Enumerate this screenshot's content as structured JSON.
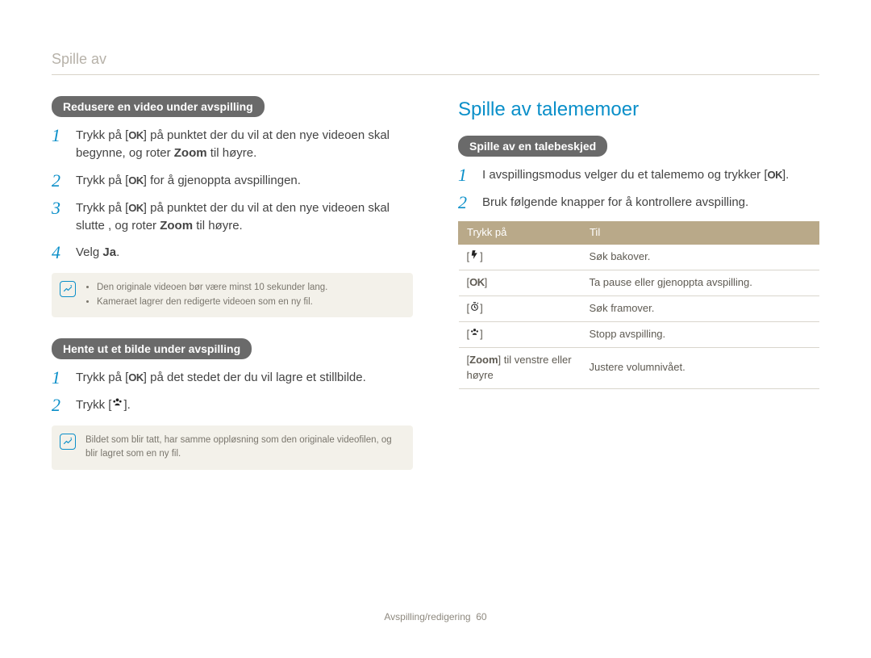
{
  "header": {
    "title": "Spille av"
  },
  "left": {
    "section_a": {
      "label": "Redusere en video under avspilling",
      "steps": [
        {
          "n": "1",
          "pre": "Trykk på [",
          "ok": "OK",
          "post": "] på punktet der du vil at den nye videoen skal begynne, og roter ",
          "zoom": "Zoom",
          "tail": " til høyre."
        },
        {
          "n": "2",
          "pre": "Trykk på [",
          "ok": "OK",
          "post": "] for å gjenoppta avspillingen."
        },
        {
          "n": "3",
          "pre": "Trykk på [",
          "ok": "OK",
          "post": "] på punktet der du vil at den nye videoen skal slutte , og roter ",
          "zoom": "Zoom",
          "tail": " til høyre."
        },
        {
          "n": "4",
          "text_pre": "Velg ",
          "ja": "Ja",
          "text_post": "."
        }
      ],
      "note": [
        "Den originale videoen bør være minst 10 sekunder lang.",
        "Kameraet lagrer den redigerte videoen som en ny fil."
      ]
    },
    "section_b": {
      "label": "Hente ut et bilde under avspilling",
      "steps": [
        {
          "n": "1",
          "pre": "Trykk på [",
          "ok": "OK",
          "post": "] på det stedet der du vil lagre et stillbilde."
        },
        {
          "n": "2",
          "text": "Trykk [",
          "icon": "macro",
          "tail": "]."
        }
      ],
      "note": "Bildet som blir tatt, har samme oppløsning som den originale videofilen, og blir lagret som en ny fil."
    }
  },
  "right": {
    "title": "Spille av talememoer",
    "section": {
      "label": "Spille av en talebeskjed",
      "steps": [
        {
          "n": "1",
          "pre": "I avspillingsmodus velger du et talememo og trykker [",
          "ok": "OK",
          "post": "]."
        },
        {
          "n": "2",
          "text": "Bruk følgende knapper for å kontrollere avspilling."
        }
      ]
    },
    "table": {
      "headers": [
        "Trykk på",
        "Til"
      ],
      "rows": [
        {
          "press_icon": "flash",
          "press_lbl": "[",
          "press_rbl": "]",
          "to": "Søk bakover."
        },
        {
          "press_icon": "ok",
          "press_lbl": "[",
          "press_rbl": "]",
          "to": "Ta pause eller gjenoppta avspilling."
        },
        {
          "press_icon": "timer",
          "press_lbl": "[",
          "press_rbl": "]",
          "to": "Søk framover."
        },
        {
          "press_icon": "macro",
          "press_lbl": "[",
          "press_rbl": "]",
          "to": "Stopp avspilling."
        },
        {
          "press_text_pre": "[",
          "press_text_bold": "Zoom",
          "press_text_post": "] til venstre eller høyre",
          "to": "Justere volumnivået."
        }
      ]
    }
  },
  "footer": {
    "section": "Avspilling/redigering",
    "page": "60"
  },
  "icons": {
    "ok": "OK"
  }
}
